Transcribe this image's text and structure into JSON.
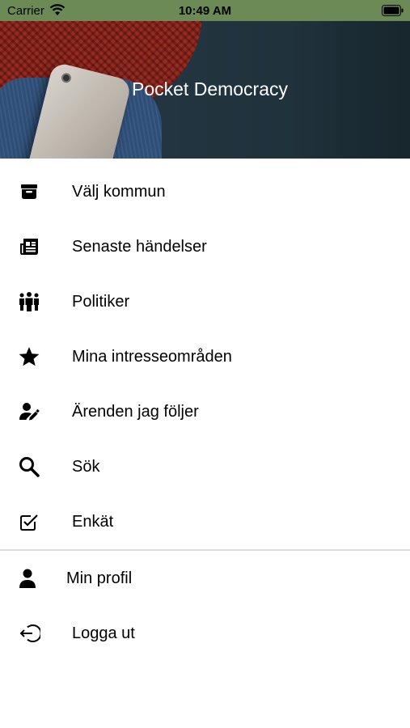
{
  "status_bar": {
    "carrier": "Carrier",
    "time": "10:49 AM"
  },
  "header": {
    "title": "Pocket Democracy"
  },
  "menu": {
    "items": [
      {
        "label": "Välj kommun",
        "icon": "archive-icon"
      },
      {
        "label": "Senaste händelser",
        "icon": "newspaper-icon"
      },
      {
        "label": "Politiker",
        "icon": "people-icon"
      },
      {
        "label": "Mina intresseområden",
        "icon": "star-icon"
      },
      {
        "label": "Ärenden jag följer",
        "icon": "user-edit-icon"
      },
      {
        "label": "Sök",
        "icon": "search-icon"
      },
      {
        "label": "Enkät",
        "icon": "checkbox-icon"
      }
    ],
    "footer_items": [
      {
        "label": "Min profil",
        "icon": "user-icon"
      },
      {
        "label": "Logga ut",
        "icon": "logout-icon"
      }
    ]
  },
  "colors": {
    "status_bar": "#6c8a55",
    "text": "#000000",
    "divider": "#dcdcdc"
  }
}
